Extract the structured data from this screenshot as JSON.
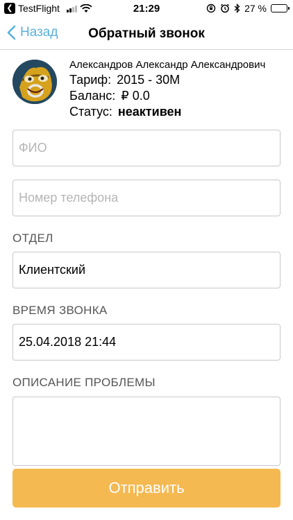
{
  "status_bar": {
    "back_app": "TestFlight",
    "time": "21:29",
    "battery_percent": "27 %",
    "battery_level": 0.27
  },
  "nav": {
    "back_label": "Назад",
    "title": "Обратный звонок"
  },
  "profile": {
    "name": "Александров Александр Александрович",
    "tariff_label": "Тариф:",
    "tariff_value": "2015 - 30M",
    "balance_label": "Баланс:",
    "balance_value": "₽ 0.0",
    "status_label": "Статус:",
    "status_value": "неактивен"
  },
  "form": {
    "fio_placeholder": "ФИО",
    "phone_placeholder": "Номер телефона",
    "department_label": "ОТДЕЛ",
    "department_value": "Клиентский",
    "call_time_label": "ВРЕМЯ ЗВОНКА",
    "call_time_value": "25.04.2018 21:44",
    "description_label": "ОПИСАНИЕ ПРОБЛЕМЫ",
    "description_value": "",
    "submit_label": "Отправить"
  },
  "colors": {
    "accent": "#5ab0dd",
    "submit": "#f5b951"
  }
}
